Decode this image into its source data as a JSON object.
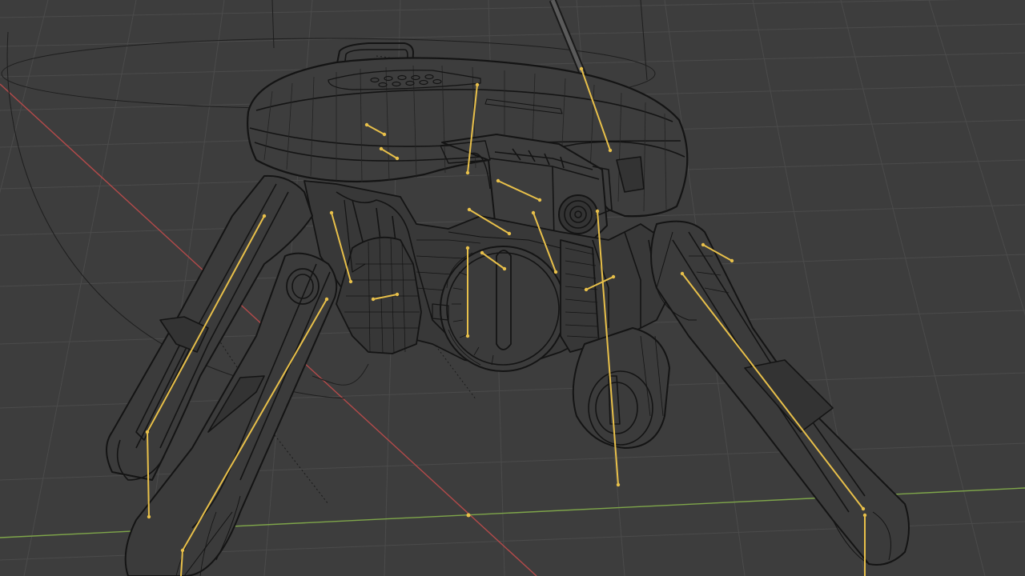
{
  "viewport": {
    "background": "#3d3d3d",
    "grid_color": "#4b4b4b",
    "axis_x_color": "#b34a4a",
    "axis_y_color": "#7fa64a",
    "wire_color": "#141414",
    "selection_color": "#e8c04a"
  },
  "scene": {
    "object": "robot-wireframe",
    "display_mode": "wireframe",
    "bones_visible": true
  }
}
